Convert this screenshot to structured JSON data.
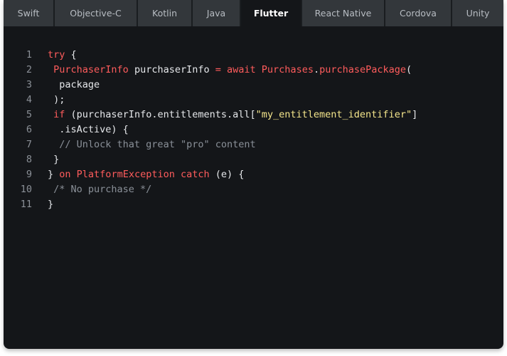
{
  "tabs": [
    {
      "label": "Swift",
      "active": false
    },
    {
      "label": "Objective-C",
      "active": false
    },
    {
      "label": "Kotlin",
      "active": false
    },
    {
      "label": "Java",
      "active": false
    },
    {
      "label": "Flutter",
      "active": true
    },
    {
      "label": "React Native",
      "active": false
    },
    {
      "label": "Cordova",
      "active": false
    },
    {
      "label": "Unity",
      "active": false
    }
  ],
  "code": {
    "line_numbers": [
      "1",
      "2",
      "3",
      "4",
      "5",
      "6",
      "7",
      "8",
      "9",
      "10",
      "11"
    ],
    "lines": [
      [
        {
          "t": "kw",
          "s": "try"
        },
        {
          "t": "pl",
          "s": " {"
        }
      ],
      [
        {
          "t": "pl",
          "s": " "
        },
        {
          "t": "ty",
          "s": "PurchaserInfo"
        },
        {
          "t": "pl",
          "s": " purchaserInfo "
        },
        {
          "t": "kw",
          "s": "="
        },
        {
          "t": "pl",
          "s": " "
        },
        {
          "t": "kw",
          "s": "await"
        },
        {
          "t": "pl",
          "s": " "
        },
        {
          "t": "ty",
          "s": "Purchases"
        },
        {
          "t": "pl",
          "s": "."
        },
        {
          "t": "fn",
          "s": "purchasePackage"
        },
        {
          "t": "pl",
          "s": "("
        }
      ],
      [
        {
          "t": "pl",
          "s": "  package"
        }
      ],
      [
        {
          "t": "pl",
          "s": " );"
        }
      ],
      [
        {
          "t": "pl",
          "s": " "
        },
        {
          "t": "kw",
          "s": "if"
        },
        {
          "t": "pl",
          "s": " (purchaserInfo.entitlements.all["
        },
        {
          "t": "str",
          "s": "\"my_entitlement_identifier\""
        },
        {
          "t": "pl",
          "s": "]"
        }
      ],
      [
        {
          "t": "pl",
          "s": "  .isActive) {"
        }
      ],
      [
        {
          "t": "pl",
          "s": "  "
        },
        {
          "t": "cm",
          "s": "// Unlock that great \"pro\" content"
        }
      ],
      [
        {
          "t": "pl",
          "s": " }"
        }
      ],
      [
        {
          "t": "pl",
          "s": "} "
        },
        {
          "t": "kw",
          "s": "on"
        },
        {
          "t": "pl",
          "s": " "
        },
        {
          "t": "ty",
          "s": "PlatformException"
        },
        {
          "t": "pl",
          "s": " "
        },
        {
          "t": "kw",
          "s": "catch"
        },
        {
          "t": "pl",
          "s": " (e) {"
        }
      ],
      [
        {
          "t": "pl",
          "s": " "
        },
        {
          "t": "cm",
          "s": "/* No purchase */"
        }
      ],
      [
        {
          "t": "pl",
          "s": "}"
        }
      ]
    ]
  },
  "colors": {
    "keyword": "#ff5c5c",
    "string": "#f5e68c",
    "comment": "#8a9098",
    "plain": "#e6e8eb",
    "background": "#141619",
    "tab_background": "#33373b"
  }
}
